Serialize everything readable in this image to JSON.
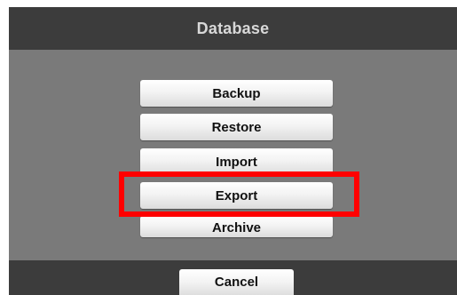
{
  "window": {
    "title": "Database"
  },
  "menu": {
    "items": [
      {
        "label": "Backup"
      },
      {
        "label": "Restore"
      },
      {
        "label": "Import"
      },
      {
        "label": "Export"
      },
      {
        "label": "Archive"
      }
    ],
    "highlighted_item": "Export"
  },
  "footer": {
    "cancel_label": "Cancel"
  },
  "colors": {
    "title_bar": "#3c3c3c",
    "panel": "#7a7a7a",
    "highlight": "#ff0000",
    "button_face": "#f3f3f3"
  }
}
